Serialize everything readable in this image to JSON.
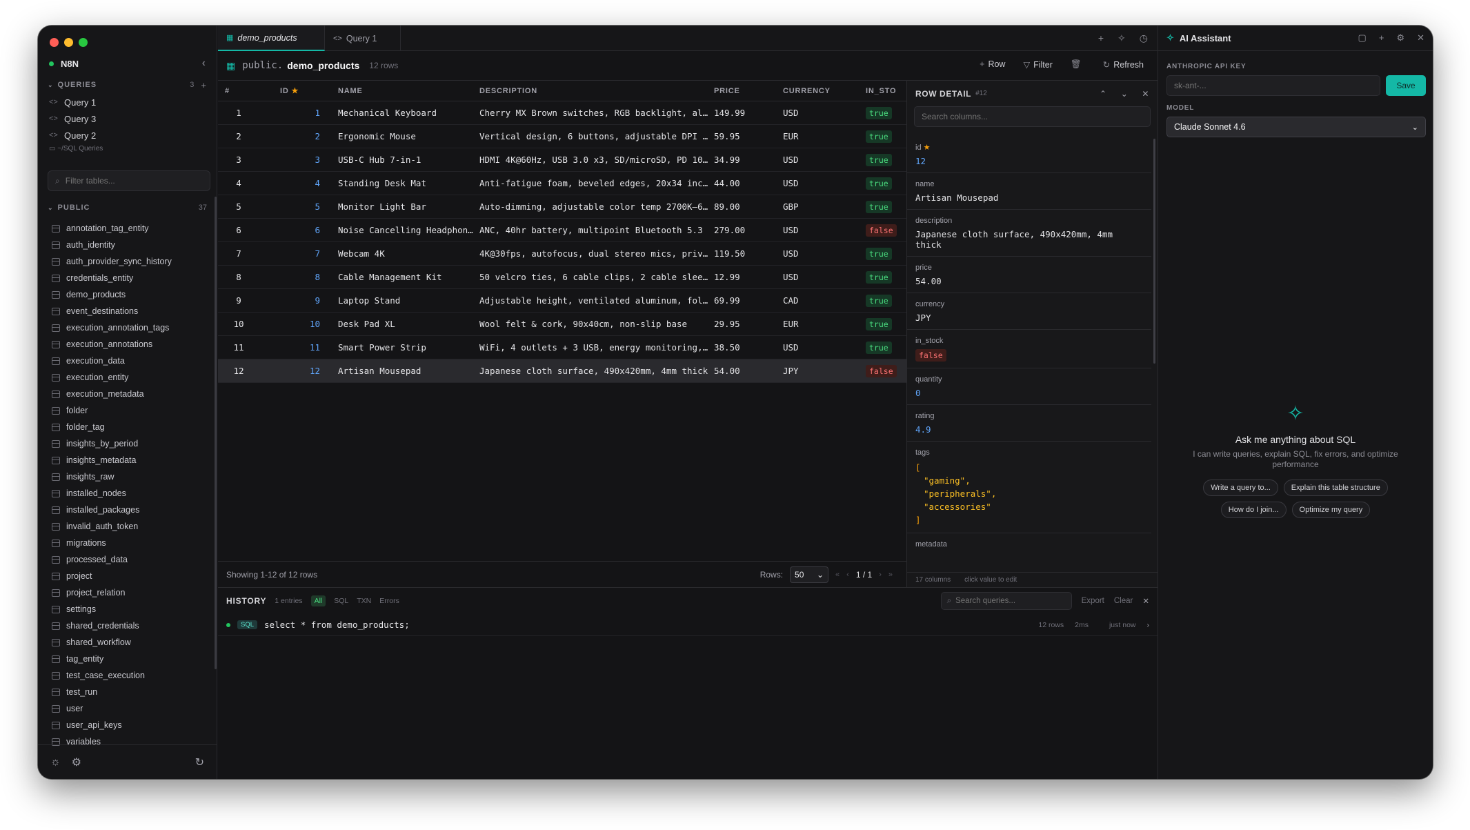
{
  "sidebar": {
    "connection": "N8N",
    "queries_heading": "QUERIES",
    "queries_count": "3",
    "queries": [
      "Query 1",
      "Query 3",
      "Query 2"
    ],
    "sql_queries_folder": "~/SQL Queries",
    "filter_placeholder": "Filter tables...",
    "schema_heading": "PUBLIC",
    "schema_count": "37",
    "tables": [
      "annotation_tag_entity",
      "auth_identity",
      "auth_provider_sync_history",
      "credentials_entity",
      "demo_products",
      "event_destinations",
      "execution_annotation_tags",
      "execution_annotations",
      "execution_data",
      "execution_entity",
      "execution_metadata",
      "folder",
      "folder_tag",
      "insights_by_period",
      "insights_metadata",
      "insights_raw",
      "installed_nodes",
      "installed_packages",
      "invalid_auth_token",
      "migrations",
      "processed_data",
      "project",
      "project_relation",
      "settings",
      "shared_credentials",
      "shared_workflow",
      "tag_entity",
      "test_case_execution",
      "test_run",
      "user",
      "user_api_keys",
      "variables"
    ]
  },
  "tabs": [
    {
      "label": "demo_products",
      "icon": "table-icon"
    },
    {
      "label": "Query 1",
      "icon": "code-icon"
    }
  ],
  "toolbar": {
    "schema": "public.",
    "table": "demo_products",
    "row_count": "12 rows",
    "add_row": "Row",
    "filter": "Filter",
    "refresh": "Refresh"
  },
  "grid": {
    "columns": [
      "#",
      "ID",
      "NAME",
      "DESCRIPTION",
      "PRICE",
      "CURRENCY",
      "IN_STO"
    ],
    "rows": [
      {
        "n": "1",
        "id": "1",
        "name": "Mechanical Keyboard",
        "description": "Cherry MX Brown switches, RGB backlight, al…",
        "price": "149.99",
        "currency": "USD",
        "in_stock": "true"
      },
      {
        "n": "2",
        "id": "2",
        "name": "Ergonomic Mouse",
        "description": "Vertical design, 6 buttons, adjustable DPI …",
        "price": "59.95",
        "currency": "EUR",
        "in_stock": "true"
      },
      {
        "n": "3",
        "id": "3",
        "name": "USB-C Hub 7-in-1",
        "description": "HDMI 4K@60Hz, USB 3.0 x3, SD/microSD, PD 10…",
        "price": "34.99",
        "currency": "USD",
        "in_stock": "true"
      },
      {
        "n": "4",
        "id": "4",
        "name": "Standing Desk Mat",
        "description": "Anti-fatigue foam, beveled edges, 20x34 inc…",
        "price": "44.00",
        "currency": "USD",
        "in_stock": "true"
      },
      {
        "n": "5",
        "id": "5",
        "name": "Monitor Light Bar",
        "description": "Auto-dimming, adjustable color temp 2700K–6…",
        "price": "89.00",
        "currency": "GBP",
        "in_stock": "true"
      },
      {
        "n": "6",
        "id": "6",
        "name": "Noise Cancelling Headphones",
        "description": "ANC, 40hr battery, multipoint Bluetooth 5.3",
        "price": "279.00",
        "currency": "USD",
        "in_stock": "false"
      },
      {
        "n": "7",
        "id": "7",
        "name": "Webcam 4K",
        "description": "4K@30fps, autofocus, dual stereo mics, priv…",
        "price": "119.50",
        "currency": "USD",
        "in_stock": "true"
      },
      {
        "n": "8",
        "id": "8",
        "name": "Cable Management Kit",
        "description": "50 velcro ties, 6 cable clips, 2 cable slee…",
        "price": "12.99",
        "currency": "USD",
        "in_stock": "true"
      },
      {
        "n": "9",
        "id": "9",
        "name": "Laptop Stand",
        "description": "Adjustable height, ventilated aluminum, fol…",
        "price": "69.99",
        "currency": "CAD",
        "in_stock": "true"
      },
      {
        "n": "10",
        "id": "10",
        "name": "Desk Pad XL",
        "description": "Wool felt & cork, 90x40cm, non-slip base",
        "price": "29.95",
        "currency": "EUR",
        "in_stock": "true"
      },
      {
        "n": "11",
        "id": "11",
        "name": "Smart Power Strip",
        "description": "WiFi, 4 outlets + 3 USB, energy monitoring,…",
        "price": "38.50",
        "currency": "USD",
        "in_stock": "true"
      },
      {
        "n": "12",
        "id": "12",
        "name": "Artisan Mousepad",
        "description": "Japanese cloth surface, 490x420mm, 4mm thick",
        "price": "54.00",
        "currency": "JPY",
        "in_stock": "false"
      }
    ],
    "selected_index": 11
  },
  "footer": {
    "showing": "Showing 1-12 of 12 rows",
    "rows_label": "Rows:",
    "rows_value": "50",
    "page": "1 / 1"
  },
  "detail": {
    "title": "ROW DETAIL",
    "row_tag": "#12",
    "search_placeholder": "Search columns...",
    "fields": {
      "id_label": "id",
      "id_value": "12",
      "name_label": "name",
      "name_value": "Artisan Mousepad",
      "description_label": "description",
      "description_value": "Japanese cloth surface, 490x420mm, 4mm thick",
      "price_label": "price",
      "price_value": "54.00",
      "currency_label": "currency",
      "currency_value": "JPY",
      "in_stock_label": "in_stock",
      "in_stock_value": "false",
      "quantity_label": "quantity",
      "quantity_value": "0",
      "rating_label": "rating",
      "rating_value": "4.9",
      "tags_label": "tags",
      "tags_open": "[",
      "tags_close": "]",
      "tags": [
        "\"gaming\",",
        "\"peripherals\",",
        "\"accessories\""
      ],
      "metadata_label": "metadata"
    },
    "columns_count": "17 columns",
    "hint": "click value to edit"
  },
  "history": {
    "title": "HISTORY",
    "entries": "1 entries",
    "filters": [
      "All",
      "SQL",
      "TXN",
      "Errors"
    ],
    "search_placeholder": "Search queries...",
    "export": "Export",
    "clear": "Clear",
    "items": [
      {
        "type": "SQL",
        "query": "select * from demo_products;",
        "rows": "12 rows",
        "duration": "2ms",
        "time": "just now"
      }
    ]
  },
  "ai": {
    "title": "AI Assistant",
    "api_key_label": "ANTHROPIC API KEY",
    "api_key_placeholder": "sk-ant-...",
    "save": "Save",
    "model_label": "MODEL",
    "model_value": "Claude Sonnet 4.6",
    "empty_heading": "Ask me anything about SQL",
    "empty_desc": "I can write queries, explain SQL, fix errors, and optimize performance",
    "suggestions": [
      "Write a query to...",
      "Explain this table structure",
      "How do I join...",
      "Optimize my query"
    ]
  },
  "colors": {
    "accent": "#14b8a6",
    "success": "#22c55e",
    "danger": "#f87171",
    "number": "#60a5fa"
  }
}
